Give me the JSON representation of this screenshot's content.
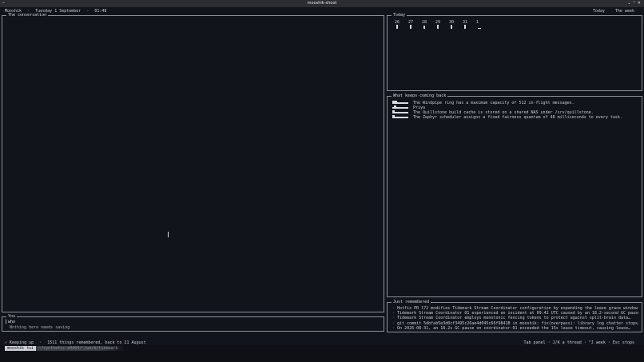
{
  "window": {
    "title": "mooshik-shoot"
  },
  "header": {
    "app": "Mooshik",
    "date": "Tuesday 1 September",
    "time": "01:48",
    "sep": "·",
    "nav_today": "Today",
    "nav_week": "The week"
  },
  "conversation": {
    "title": "The conversation"
  },
  "input": {
    "title": "You",
    "value": "who",
    "hint": "Nothing here needs saving"
  },
  "today": {
    "title": "Today",
    "days": [
      "26",
      "27",
      "28",
      "29",
      "30",
      "31",
      "1"
    ],
    "levels": [
      0.6,
      0.6,
      0.5,
      0.6,
      0.6,
      0.6,
      0.1
    ]
  },
  "recurring": {
    "title": "What keeps coming back",
    "items": [
      {
        "text": "The Windpipe ring has a maximum capacity of 512 in-flight messages."
      },
      {
        "text": "Priya"
      },
      {
        "text": "The Quillstone build cache is stored on a shared NAS under /srv/quillstone."
      },
      {
        "text": "The Zephyr scheduler assigns a fixed fairness quantum of 48 milliseconds to every task."
      }
    ]
  },
  "remembered": {
    "title": "Just remembered",
    "items": [
      "Hotfix PR 172 modifies Tidemark Stream Coordinator configuration by expanding the lease grace window from…",
      "Tidemark Stream Coordinator 01 experienced an incident at 09:42 UTC caused by an 18.2-second GC pause…",
      "Tidemark Stream Coordinator employs monotonic fencing tokens to protect against split-brain data…",
      "git commit 5dbfab5e3d0cf3495c26ae4d045c66f9841B in mooshik: fix(overpass): library log chatter stops…",
      "On 2026-08-31, an 18.2s GC pause on coordinator-01 exceeded the 15s lease timeout, causing lease…"
    ]
  },
  "status": {
    "check": "✓",
    "state": "Keeping up",
    "dot": "·",
    "memory": "1511 things remembered, back to 21 August",
    "keys": "Tab panel · J/K a thread · ^J week · Esc stops"
  },
  "tmux": {
    "active": "mooshik tui",
    "inactive": "~/synthetic-e0d04/~/work/tidemark"
  }
}
